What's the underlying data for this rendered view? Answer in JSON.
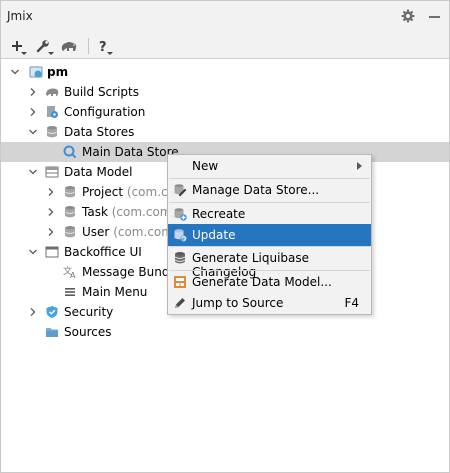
{
  "panel": {
    "title": "Jmix"
  },
  "toolbar": [
    {
      "name": "add-icon"
    },
    {
      "name": "wrench-icon"
    },
    {
      "name": "gradle-elephant-icon"
    },
    {
      "name": "help-icon"
    }
  ],
  "tree": {
    "root": "pm",
    "build_scripts": "Build Scripts",
    "configuration": "Configuration",
    "data_stores": "Data Stores",
    "main_data_store": "Main Data Store",
    "data_model": "Data Model",
    "project": "Project",
    "project_pkg": "(com.co",
    "task": "Task",
    "task_pkg": "(com.com",
    "user": "User",
    "user_pkg": "(com.com",
    "backoffice_ui": "Backoffice UI",
    "message_bundle": "Message Bundle",
    "main_menu": "Main Menu",
    "security": "Security",
    "sources": "Sources"
  },
  "context_menu": {
    "new": "New",
    "manage_data_store": "Manage Data Store...",
    "recreate": "Recreate",
    "update": "Update",
    "generate_liquibase": "Generate Liquibase Changelog",
    "generate_data_model": "Generate Data Model...",
    "jump_to_source": "Jump to Source",
    "jump_to_source_shortcut": "F4",
    "highlighted": "Update"
  },
  "colors": {
    "selection": "#d4d4d4",
    "menu_highlight": "#2675bf",
    "panel_bg": "#f2f2f2"
  }
}
